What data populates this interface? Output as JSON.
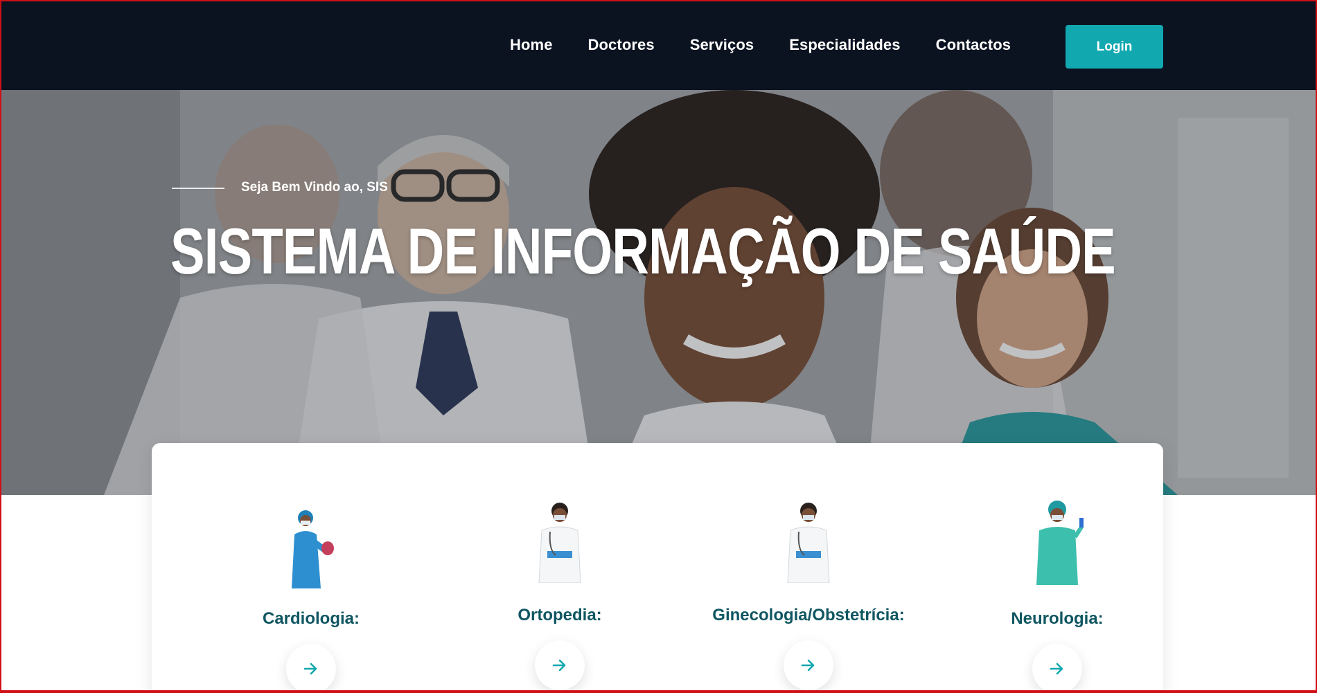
{
  "nav": {
    "items": [
      {
        "label": "Home"
      },
      {
        "label": "Doctores"
      },
      {
        "label": "Serviços"
      },
      {
        "label": "Especialidades"
      },
      {
        "label": "Contactos"
      }
    ],
    "login_label": "Login"
  },
  "hero": {
    "welcome": "Seja Bem Vindo ao, SIS",
    "title": "SISTEMA DE INFORMAÇÃO DE SAÚDE"
  },
  "specialties": [
    {
      "label": "Cardiologia:",
      "icon": "doctor-blue-gown-icon"
    },
    {
      "label": "Ortopedia:",
      "icon": "doctor-white-coat-icon"
    },
    {
      "label": "Ginecologia/Obstetrícia:",
      "icon": "doctor-white-coat-icon"
    },
    {
      "label": "Neurologia:",
      "icon": "nurse-teal-scrubs-icon"
    }
  ],
  "colors": {
    "navbar": "#0b1220",
    "accent": "#12a8b0",
    "label": "#0f5661"
  }
}
